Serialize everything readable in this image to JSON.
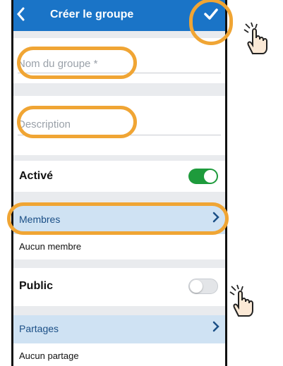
{
  "header": {
    "back_icon": "‹",
    "title": "Créer le groupe",
    "confirm_icon": "✓"
  },
  "form": {
    "name_placeholder": "Nom du groupe *",
    "description_placeholder": "Description",
    "active": {
      "label": "Activé",
      "on": true
    },
    "members": {
      "label": "Membres",
      "empty": "Aucun membre"
    },
    "public": {
      "label": "Public",
      "on": false
    },
    "shares": {
      "label": "Partages",
      "empty": "Aucun partage"
    }
  },
  "colors": {
    "accent": "#1a74c7",
    "toggle_on": "#1e9b3c",
    "highlight": "#f0a534",
    "section_bg": "#cfe2f3"
  }
}
